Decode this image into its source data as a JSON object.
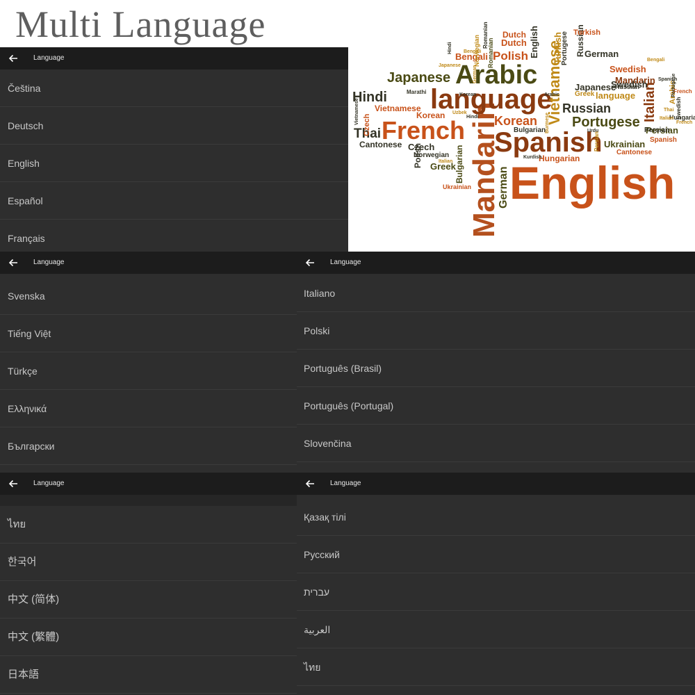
{
  "headline": "Multi Language",
  "screen_title": "Language",
  "panels": {
    "p1": {
      "title": "Language",
      "items": [
        "Čeština",
        "Deutsch",
        "English",
        "Español",
        "Français"
      ]
    },
    "p2": {
      "title": "Language",
      "items": [
        "Svenska",
        "Tiếng Việt",
        "Türkçe",
        "Ελληνικά",
        "Български"
      ]
    },
    "p3": {
      "title": "Language",
      "items": [
        "Italiano",
        "Polski",
        "Português (Brasil)",
        "Português (Portugal)",
        "Slovenčina"
      ]
    },
    "p4": {
      "title": "Language",
      "items": [
        "ไทย",
        "한국어",
        "中文 (简体)",
        "中文 (繁體)",
        "日本語"
      ]
    },
    "p5": {
      "title": "Language",
      "items": [
        "Қазақ тілі",
        "Русский",
        "עברית",
        "العربية",
        "ไทย"
      ]
    }
  },
  "word_cloud": [
    "English",
    "Mandarin",
    "Spanish",
    "French",
    "language",
    "Arabic",
    "Japanese",
    "Hindi",
    "Portugese",
    "Russian",
    "Korean",
    "Vietnamese",
    "Italian",
    "German",
    "Polish",
    "Dutch",
    "Turkish",
    "Bengali",
    "Romanian",
    "Czech",
    "Thai",
    "Cantonese",
    "Greek",
    "Bulgarian",
    "Hungarian",
    "Ukrainian",
    "Swedish",
    "Persian",
    "Norwegian",
    "Mandarin",
    "language",
    "Spanish",
    "Swedish",
    "Japanese",
    "Persian",
    "Vietnamese",
    "Ukrainian",
    "Cantonese",
    "Russian",
    "Marathi",
    "Uzbek",
    "Bengali",
    "Kurdish",
    "Urdu",
    "Burmese",
    "Arabic",
    "Hindi",
    "Italian",
    "Greek",
    "Swedish",
    "French",
    "German",
    "Norwegian",
    "English",
    "Bulgarian",
    "Czech",
    "Polish",
    "Hungarian",
    "Romanian",
    "Portugese",
    "Korean",
    "Vietnamese",
    "Turkish",
    "Dutch",
    "Hindi",
    "Thai",
    "Japanese",
    "Russian",
    "Italian",
    "Arabic",
    "Portugese",
    "Persian",
    "Spanish",
    "German",
    "French",
    "Korean",
    "Bengali"
  ],
  "colors": {
    "panel_bg": "#2e2e2e",
    "bar_bg": "#1c1c1c",
    "divider": "#3b3b3b",
    "list_text": "#c8c8c8",
    "headline_text": "#5e5e5e",
    "cloud_orange": "#c8521a",
    "cloud_brown": "#8a3a10",
    "cloud_olive": "#4a4a14",
    "cloud_gold": "#c08a18",
    "cloud_dark": "#333326"
  }
}
